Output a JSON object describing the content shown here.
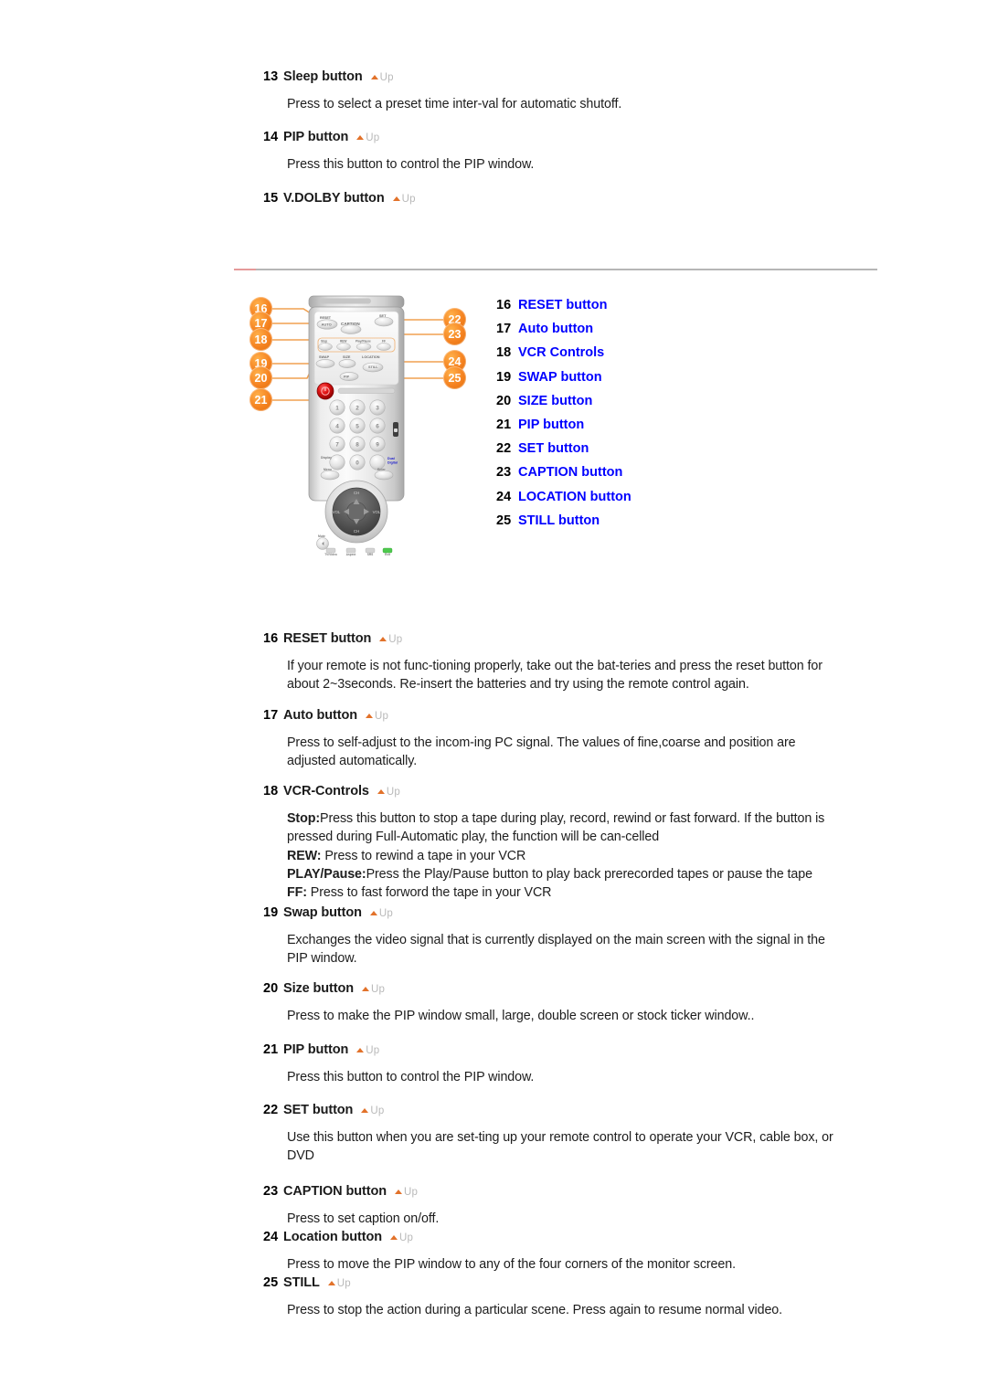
{
  "up_badge": {
    "label": "Up",
    "triangle_color": "#e2722a",
    "text_color": "#b9b9b9",
    "icon": "up-arrow-icon"
  },
  "divider": {
    "line_color": "#b6b6b6",
    "accent_color": "#e59a9a"
  },
  "top_sections": [
    {
      "num": "13",
      "label": "Sleep button",
      "body": [
        "Press to select a preset time inter-val for automatic shutoff."
      ]
    },
    {
      "num": "14",
      "label": "PIP button",
      "body": [
        "Press this button to control the PIP window."
      ]
    },
    {
      "num": "15",
      "label": "V.DOLBY button",
      "body": []
    }
  ],
  "legend": {
    "accent_color": "#0000ff",
    "items": [
      {
        "num": "16",
        "label": "RESET button"
      },
      {
        "num": "17",
        "label": "Auto button"
      },
      {
        "num": "18",
        "label": "VCR Controls"
      },
      {
        "num": "19",
        "label": "SWAP button"
      },
      {
        "num": "20",
        "label": "SIZE button"
      },
      {
        "num": "21",
        "label": "PIP button"
      },
      {
        "num": "22",
        "label": "SET button"
      },
      {
        "num": "23",
        "label": "CAPTION button"
      },
      {
        "num": "24",
        "label": "LOCATION button"
      },
      {
        "num": "25",
        "label": "STILL button"
      }
    ]
  },
  "figure": {
    "name": "remote-control-diagram",
    "badge_color": "#f58220",
    "power_button_color": "#d81313",
    "callouts": [
      {
        "num": "16"
      },
      {
        "num": "17"
      },
      {
        "num": "18"
      },
      {
        "num": "19"
      },
      {
        "num": "20"
      },
      {
        "num": "21"
      },
      {
        "num": "22"
      },
      {
        "num": "23"
      },
      {
        "num": "24"
      },
      {
        "num": "25"
      }
    ],
    "keypad": [
      "1",
      "2",
      "3",
      "4",
      "5",
      "6",
      "7",
      "8",
      "9",
      "0"
    ],
    "button_labels": [
      "RESET",
      "AUTO",
      "CAPTION",
      "SET",
      "Stop",
      "REW",
      "Play/Pause",
      "FF",
      "SWAP",
      "SIZE",
      "LOCATION",
      "STILL",
      "PIP",
      "Dual Digital",
      "Mute"
    ]
  },
  "bottom_sections": [
    {
      "num": "16",
      "label": "RESET button",
      "body": [
        "If your remote is not func-tioning properly, take out the bat-teries and press the reset button for",
        "about 2~3seconds. Re-insert the batteries and try using the remote control again."
      ]
    },
    {
      "num": "17",
      "label": "Auto button",
      "body": [
        "Press to self-adjust to the incom-ing PC signal. The values of fine,coarse and position are",
        "adjusted automatically."
      ]
    },
    {
      "num": "18",
      "label": "VCR-Controls",
      "rich_body": [
        {
          "bold": "Stop:",
          "text": "Press this button to stop a tape during play, record, rewind or fast forward. If the button is"
        },
        {
          "bold": "",
          "text": "pressed during Full-Automatic play, the function will be can-celled"
        },
        {
          "bold": "REW:",
          "text": " Press to rewind a tape in your VCR"
        },
        {
          "bold": "PLAY/Pause:",
          "text": "Press the Play/Pause button to play back prerecorded tapes or pause the tape"
        },
        {
          "bold": "FF:",
          "text": " Press to fast forword the tape in your VCR"
        }
      ]
    },
    {
      "num": "19",
      "label": "Swap button",
      "body": [
        "Exchanges the video signal that is currently displayed on the main screen with the signal in the",
        "PIP window."
      ]
    },
    {
      "num": "20",
      "label": "Size button",
      "body": [
        "Press to make the PIP window small, large, double screen or stock ticker window.."
      ]
    },
    {
      "num": "21",
      "label": "PIP button",
      "body": [
        "Press this button to control the PIP window."
      ]
    },
    {
      "num": "22",
      "label": "SET button",
      "body": [
        "Use this button when you are set-ting up your remote control to operate your VCR, cable box, or",
        "DVD"
      ]
    },
    {
      "num": "23",
      "label": "CAPTION button",
      "body": [
        "Press to set caption on/off."
      ]
    },
    {
      "num": "24",
      "label": "Location button",
      "body": [
        "Press to move the PIP window to any of the four corners of the monitor screen."
      ]
    },
    {
      "num": "25",
      "label": "STILL",
      "body": [
        "Press to stop the action during a particular scene. Press again to resume normal video."
      ]
    }
  ]
}
